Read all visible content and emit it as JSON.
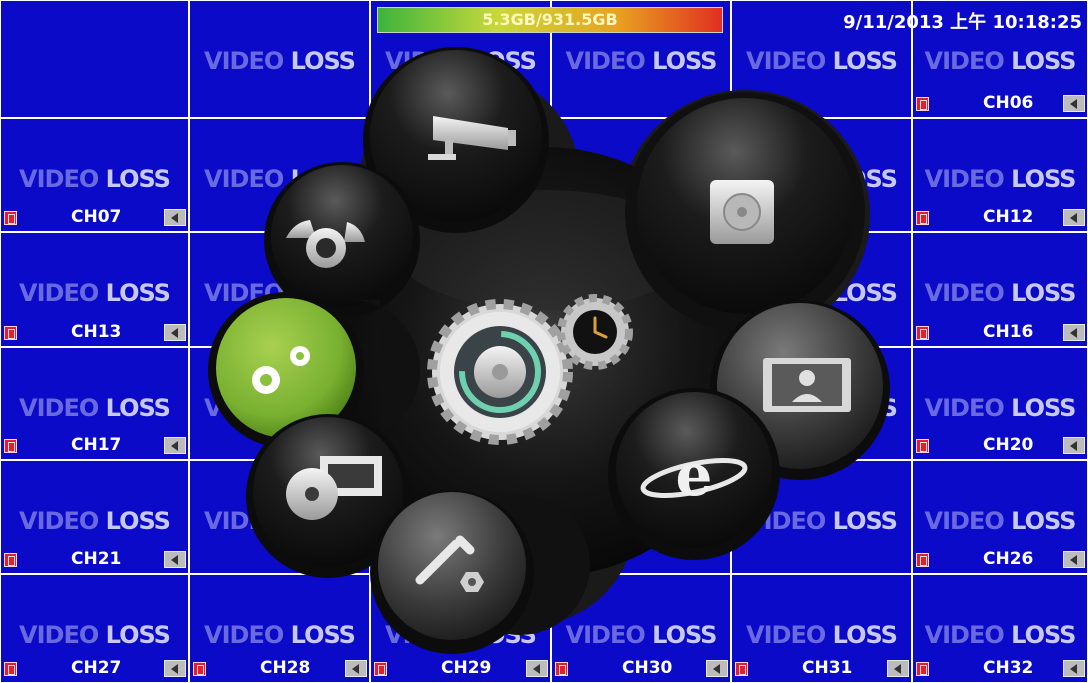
{
  "status_bar": {
    "hdd_usage": "5.3GB/931.5GB",
    "datetime": "9/11/2013 上午 10:18:25"
  },
  "video_loss_text": {
    "word1": "VIDEO",
    "word2": "LOSS"
  },
  "channel_labels": {
    "r0c5": "CH06",
    "r1c0": "CH07",
    "r1c5": "CH12",
    "r2c0": "CH13",
    "r2c5": "CH16",
    "r3c0": "CH17",
    "r3c5": "CH20",
    "r4c0": "CH21",
    "r4c5": "CH26",
    "r5c0": "CH27",
    "r5c1": "CH28",
    "r5c2": "CH29",
    "r5c3": "CH30",
    "r5c4": "CH31",
    "r5c5": "CH32"
  },
  "main_menu": {
    "items": [
      {
        "icon": "camera-icon",
        "function": "camera setup"
      },
      {
        "icon": "ptz-icon",
        "function": "PTZ"
      },
      {
        "icon": "hdd-icon",
        "function": "disk management"
      },
      {
        "icon": "system-settings-icon",
        "function": "system setup",
        "selected": true
      },
      {
        "icon": "display-icon",
        "function": "display"
      },
      {
        "icon": "playback-icon",
        "function": "record and playback"
      },
      {
        "icon": "network-icon",
        "function": "network"
      },
      {
        "icon": "maintenance-icon",
        "function": "maintenance tools"
      }
    ],
    "center_icon": "settings-gear-icon"
  },
  "colors": {
    "background_blue": "#0a0ac8",
    "selected_item": "#8cc03c"
  }
}
